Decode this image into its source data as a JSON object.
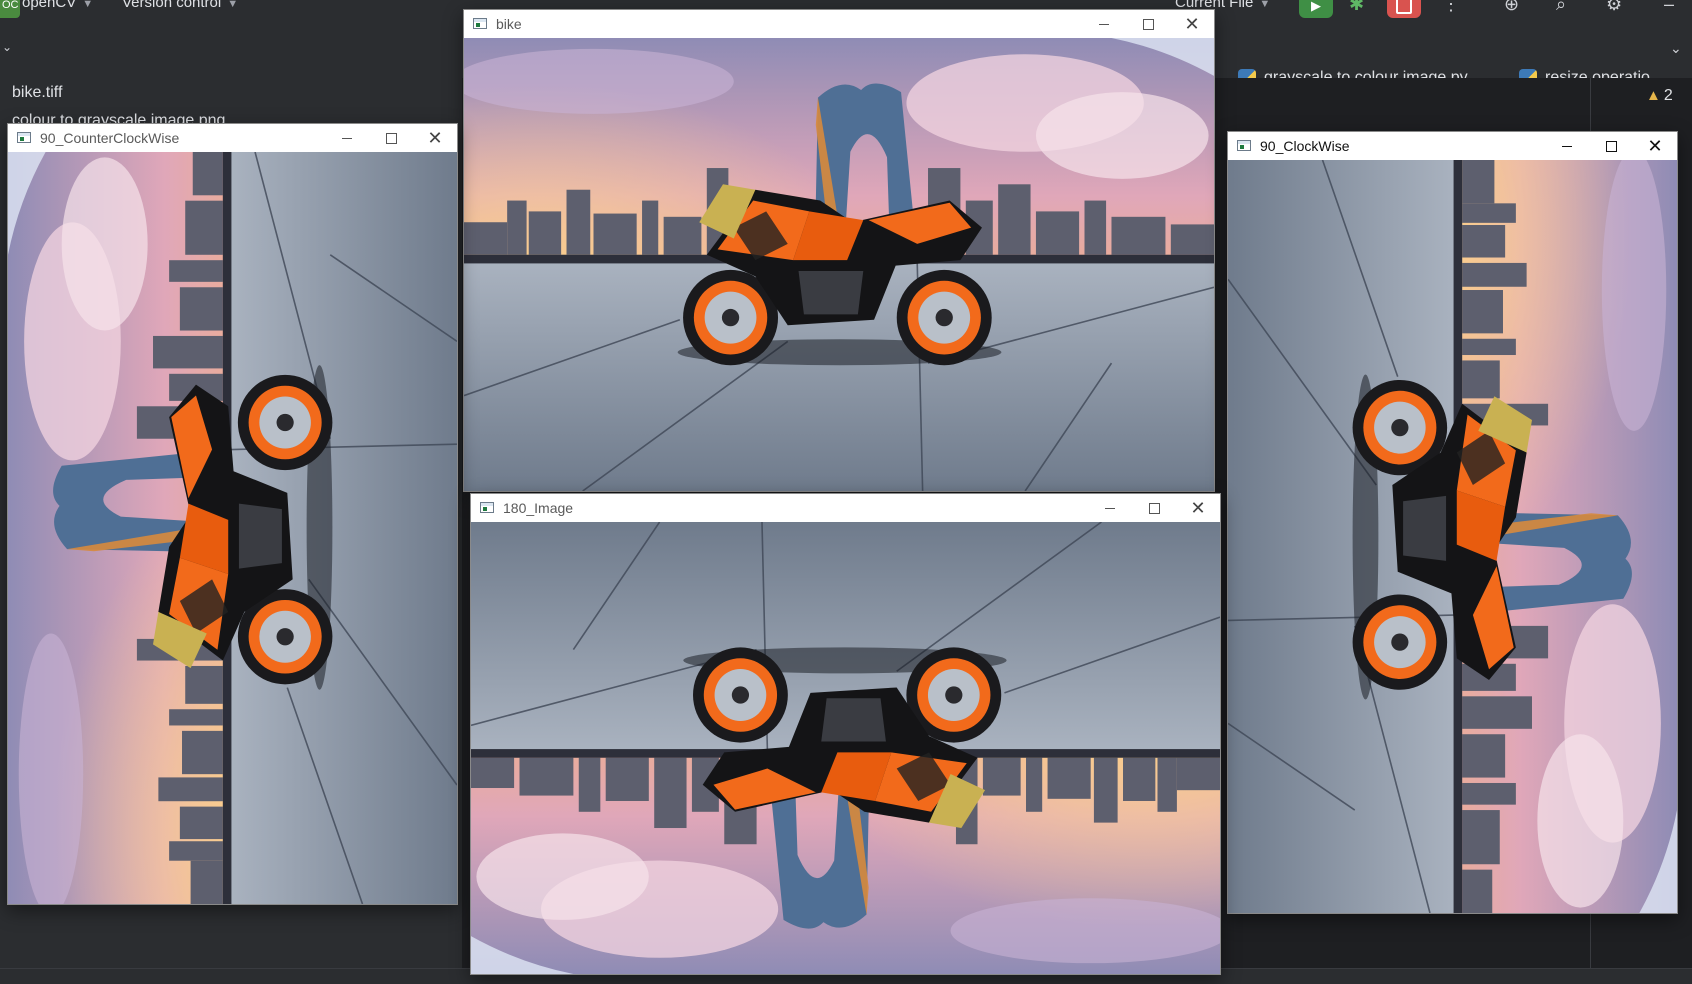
{
  "ide": {
    "project_badge": "OC",
    "project_name": "openCV",
    "vcs_label": "Version control",
    "run_config": "Current File",
    "tabs": [
      {
        "label": "grayscale to colour image.py"
      },
      {
        "label": "resize operatio"
      }
    ],
    "warnings_count": "2",
    "project_files": [
      {
        "label": "bike.tiff"
      },
      {
        "label": "colour to grayscale image.png"
      }
    ]
  },
  "windows": {
    "bike": {
      "title": "bike",
      "orientation": "upright"
    },
    "ccw": {
      "title": "90_CounterClockWise",
      "orientation": "rotated 90° counter-clockwise"
    },
    "cw": {
      "title": "90_ClockWise",
      "orientation": "rotated 90° clockwise"
    },
    "r180": {
      "title": "180_Image",
      "orientation": "rotated 180°"
    }
  },
  "colors": {
    "accent_orange": "#f26a1b",
    "run_green": "#3f8f45",
    "stop_red": "#d9534f",
    "ide_bg": "#2b2d30"
  }
}
